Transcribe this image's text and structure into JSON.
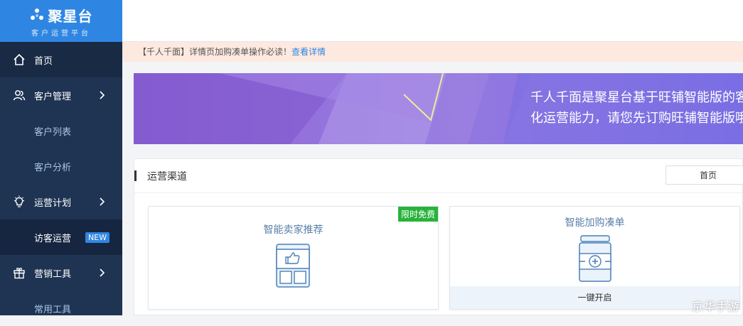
{
  "brand": {
    "name": "聚星台",
    "subtitle": "客户运营平台"
  },
  "sidebar": {
    "items": [
      {
        "label": "首页",
        "icon": "home-icon"
      },
      {
        "label": "客户管理",
        "icon": "users-icon"
      },
      {
        "label": "客户列表"
      },
      {
        "label": "客户分析"
      },
      {
        "label": "运营计划",
        "icon": "lightbulb-icon"
      },
      {
        "label": "访客运营",
        "badge": "NEW"
      },
      {
        "label": "营销工具",
        "icon": "gift-icon"
      },
      {
        "label": "常用工具"
      }
    ]
  },
  "notice": {
    "text": "【千人千面】详情页加购凑单操作必读！",
    "link": "查看详情"
  },
  "banner": {
    "line1": "千人千面是聚星台基于旺铺智能版的客",
    "line2": "化运营能力，请您先订购旺铺智能版哦"
  },
  "panel": {
    "title": "运营渠道",
    "button": "首页",
    "cards": [
      {
        "title": "智能卖家推荐",
        "badge": "限时免费",
        "icon": "thumbs-up-module-icon"
      },
      {
        "title": "智能加购凑单",
        "action": "一键开启",
        "icon": "add-module-icon"
      }
    ]
  },
  "watermark": "京华手游",
  "colors": {
    "sidebar": "#1f3453",
    "brand": "#2f86e2",
    "free_badge": "#27b33b",
    "notice_bg": "#fde9df"
  }
}
